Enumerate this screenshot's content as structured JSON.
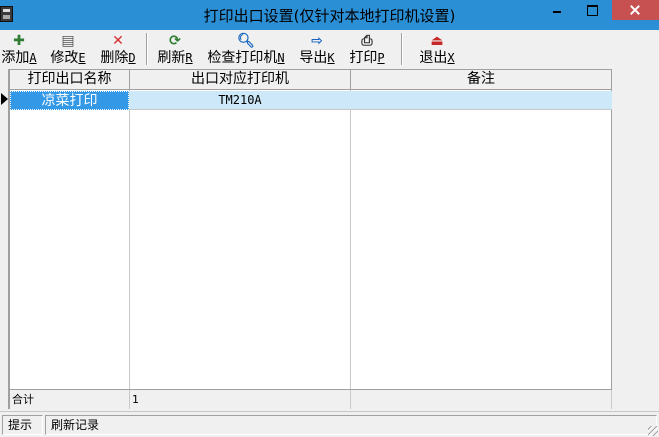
{
  "window": {
    "title": "打印出口设置(仅针对本地打印机设置)"
  },
  "toolbar": {
    "buttons": [
      {
        "label": "添加",
        "key": "A",
        "icon": "add-icon",
        "color": "#2e7d32"
      },
      {
        "label": "修改",
        "key": "E",
        "icon": "edit-icon",
        "color": "#555555"
      },
      {
        "label": "删除",
        "key": "D",
        "icon": "delete-icon",
        "color": "#d32f2f"
      },
      {
        "label": "刷新",
        "key": "R",
        "icon": "refresh-icon",
        "color": "#2e7d32"
      },
      {
        "label": "检查打印机",
        "key": "N",
        "icon": "check-printer-icon",
        "color": "#1565c0"
      },
      {
        "label": "导出",
        "key": "K",
        "icon": "export-icon",
        "color": "#1565c0"
      },
      {
        "label": "打印",
        "key": "P",
        "icon": "print-icon",
        "color": "#333333"
      },
      {
        "label": "退出",
        "key": "X",
        "icon": "exit-icon",
        "color": "#c62828"
      }
    ]
  },
  "grid": {
    "columns": [
      "打印出口名称",
      "出口对应打印机",
      "备注"
    ],
    "rows": [
      {
        "name": "凉菜打印",
        "printer": "TM210A",
        "note": ""
      }
    ],
    "footer": {
      "label": "合计",
      "count": "1"
    }
  },
  "statusbar": {
    "hint": "提示",
    "message": "刷新记录"
  },
  "colors": {
    "titlebar": "#2b8fd6",
    "close_button": "#c75050",
    "selected_cell": "#3399e6",
    "selected_row": "#cde8f8"
  }
}
